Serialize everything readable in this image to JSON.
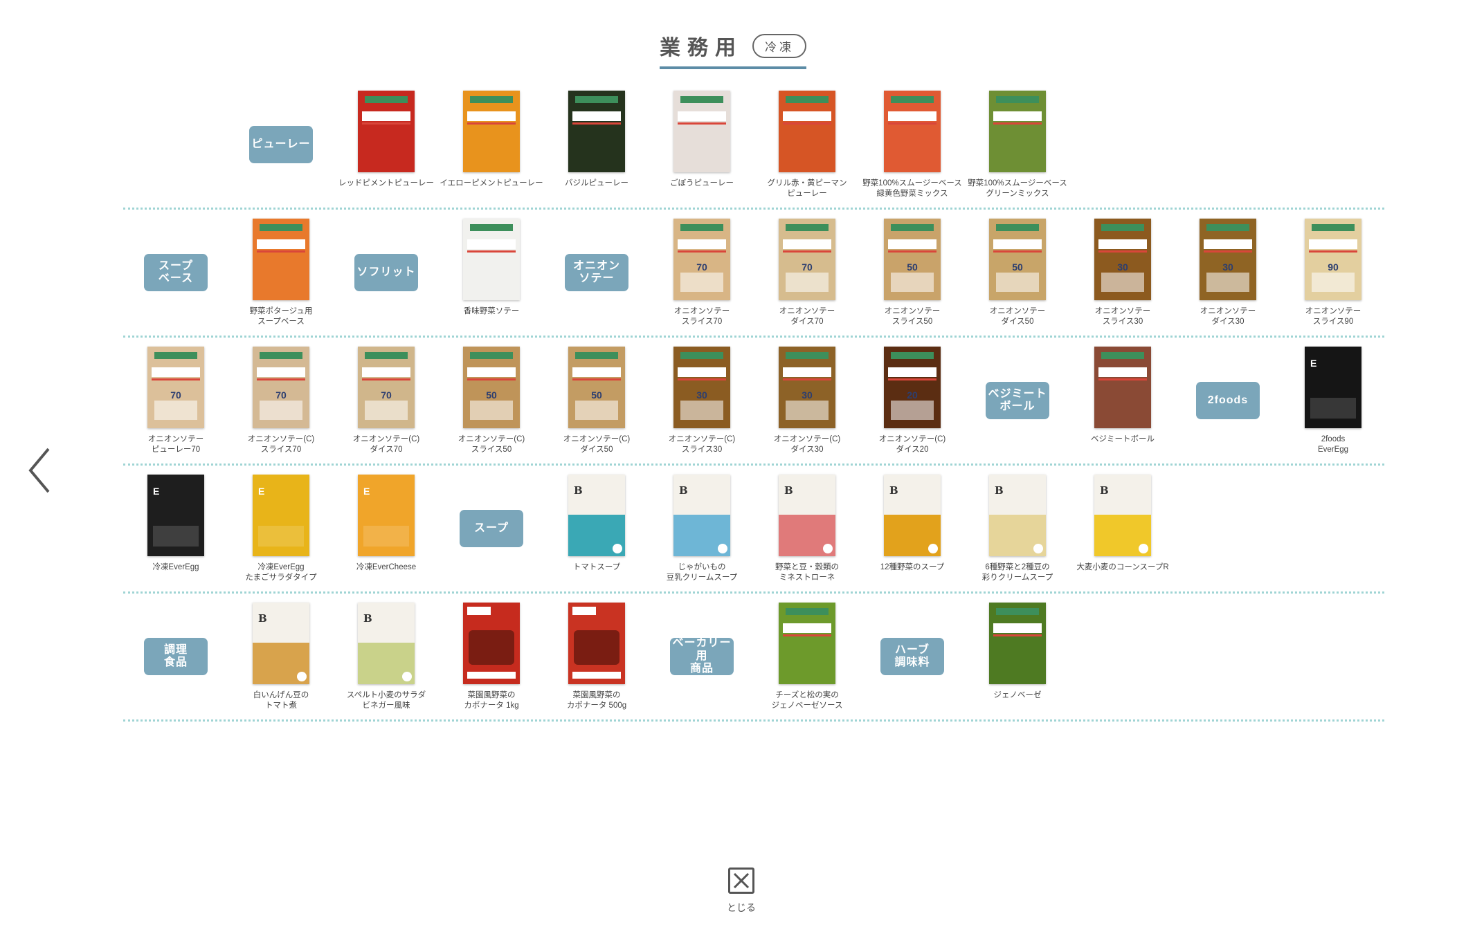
{
  "header": {
    "title": "業務用",
    "badge": "冷凍"
  },
  "close_label": "とじる",
  "rows": [
    [
      null,
      {
        "kind": "cat",
        "label": "ピューレー"
      },
      {
        "kind": "prod",
        "name": "レッドピメントピューレー",
        "color": "#c7291f",
        "style": "bag"
      },
      {
        "kind": "prod",
        "name": "イエローピメントピューレー",
        "color": "#e8931d",
        "style": "bag"
      },
      {
        "kind": "prod",
        "name": "バジルピューレー",
        "color": "#25331d",
        "style": "bag"
      },
      {
        "kind": "prod",
        "name": "ごぼうピューレー",
        "color": "#e6ded9",
        "style": "bag"
      },
      {
        "kind": "prod",
        "name": "グリル赤・黄ピーマン\nピューレー",
        "color": "#d65525",
        "style": "bag"
      },
      {
        "kind": "prod",
        "name": "野菜100%スムージーベース\n緑黄色野菜ミックス",
        "color": "#e05a33",
        "style": "bag"
      },
      {
        "kind": "prod",
        "name": "野菜100%スムージーベース\nグリーンミックス",
        "color": "#6e8f34",
        "style": "bag"
      }
    ],
    [
      {
        "kind": "cat",
        "label": "スープ\nベース"
      },
      {
        "kind": "prod",
        "name": "野菜ポタージュ用\nスープベース",
        "color": "#e8792c",
        "style": "bag"
      },
      {
        "kind": "cat",
        "label": "ソフリット"
      },
      {
        "kind": "prod",
        "name": "香味野菜ソテー",
        "color": "#f1f1ee",
        "style": "bag"
      },
      {
        "kind": "cat",
        "label": "オニオン\nソテー"
      },
      {
        "kind": "prod",
        "name": "オニオンソテー\nスライス70",
        "color": "#d8b585",
        "style": "onion",
        "num": "70"
      },
      {
        "kind": "prod",
        "name": "オニオンソテー\nダイス70",
        "color": "#d6bc8e",
        "style": "onion",
        "num": "70"
      },
      {
        "kind": "prod",
        "name": "オニオンソテー\nスライス50",
        "color": "#c9a36a",
        "style": "onion",
        "num": "50"
      },
      {
        "kind": "prod",
        "name": "オニオンソテー\nダイス50",
        "color": "#c8a569",
        "style": "onion",
        "num": "50"
      },
      {
        "kind": "prod",
        "name": "オニオンソテー\nスライス30",
        "color": "#8c5a1f",
        "style": "onion",
        "num": "30"
      },
      {
        "kind": "prod",
        "name": "オニオンソテー\nダイス30",
        "color": "#8f6424",
        "style": "onion",
        "num": "30"
      },
      {
        "kind": "prod",
        "name": "オニオンソテー\nスライス90",
        "color": "#e3cf9f",
        "style": "onion",
        "num": "90"
      }
    ],
    [
      {
        "kind": "prod",
        "name": "オニオンソテー\nピューレー70",
        "color": "#dcc09a",
        "style": "onion",
        "num": "70"
      },
      {
        "kind": "prod",
        "name": "オニオンソテー(C)\nスライス70",
        "color": "#d4b994",
        "style": "onion",
        "num": "70"
      },
      {
        "kind": "prod",
        "name": "オニオンソテー(C)\nダイス70",
        "color": "#d0b68b",
        "style": "onion",
        "num": "70"
      },
      {
        "kind": "prod",
        "name": "オニオンソテー(C)\nスライス50",
        "color": "#bf9459",
        "style": "onion",
        "num": "50"
      },
      {
        "kind": "prod",
        "name": "オニオンソテー(C)\nダイス50",
        "color": "#c39c63",
        "style": "onion",
        "num": "50"
      },
      {
        "kind": "prod",
        "name": "オニオンソテー(C)\nスライス30",
        "color": "#8b5c22",
        "style": "onion",
        "num": "30"
      },
      {
        "kind": "prod",
        "name": "オニオンソテー(C)\nダイス30",
        "color": "#8d6227",
        "style": "onion",
        "num": "30"
      },
      {
        "kind": "prod",
        "name": "オニオンソテー(C)\nダイス20",
        "color": "#5b2d12",
        "style": "onion",
        "num": "20"
      },
      {
        "kind": "cat",
        "label": "ベジミート\nボール"
      },
      {
        "kind": "prod",
        "name": "ベジミートボール",
        "color": "#8a4a35",
        "style": "bag"
      },
      {
        "kind": "cat",
        "label": "2foods"
      },
      {
        "kind": "prod",
        "name": "2foods\nEverEgg",
        "color": "#151515",
        "style": "black"
      }
    ],
    [
      {
        "kind": "prod",
        "name": "冷凍EverEgg",
        "color": "#1e1e1e",
        "style": "black"
      },
      {
        "kind": "prod",
        "name": "冷凍EverEgg\nたまごサラダタイプ",
        "color": "#e8b419",
        "style": "black"
      },
      {
        "kind": "prod",
        "name": "冷凍EverCheese",
        "color": "#f0a52a",
        "style": "black"
      },
      {
        "kind": "cat",
        "label": "スープ"
      },
      {
        "kind": "prod",
        "name": "トマトスープ",
        "color": "#3aa8b5",
        "style": "buffet"
      },
      {
        "kind": "prod",
        "name": "じゃがいもの\n豆乳クリームスープ",
        "color": "#6eb6d6",
        "style": "buffet"
      },
      {
        "kind": "prod",
        "name": "野菜と豆・穀類の\nミネストローネ",
        "color": "#e07a7a",
        "style": "buffet"
      },
      {
        "kind": "prod",
        "name": "12種野菜のスープ",
        "color": "#e2a21c",
        "style": "buffet"
      },
      {
        "kind": "prod",
        "name": "6種野菜と2種豆の\n彩りクリームスープ",
        "color": "#e6d59a",
        "style": "buffet"
      },
      {
        "kind": "prod",
        "name": "大麦小麦のコーンスープR",
        "color": "#f0c82a",
        "style": "buffet"
      },
      null,
      null
    ],
    [
      {
        "kind": "cat",
        "label": "調理\n食品"
      },
      {
        "kind": "prod",
        "name": "白いんげん豆の\nトマト煮",
        "color": "#d8a34c",
        "style": "buffet"
      },
      {
        "kind": "prod",
        "name": "スペルト小麦のサラダ\nビネガー風味",
        "color": "#c9d28a",
        "style": "buffet"
      },
      {
        "kind": "prod",
        "name": "菜園風野菜の\nカポナータ 1kg",
        "color": "#c62b1e",
        "style": "bar"
      },
      {
        "kind": "prod",
        "name": "菜園風野菜の\nカポナータ 500g",
        "color": "#c93322",
        "style": "bar"
      },
      {
        "kind": "cat",
        "label": "ベーカリー用\n商品"
      },
      {
        "kind": "prod",
        "name": "チーズと松の実の\nジェノベーゼソース",
        "color": "#6d9a2b",
        "style": "bag"
      },
      {
        "kind": "cat",
        "label": "ハーブ\n調味料"
      },
      {
        "kind": "prod",
        "name": "ジェノベーゼ",
        "color": "#4e7a22",
        "style": "bag"
      },
      null,
      null,
      null
    ]
  ]
}
